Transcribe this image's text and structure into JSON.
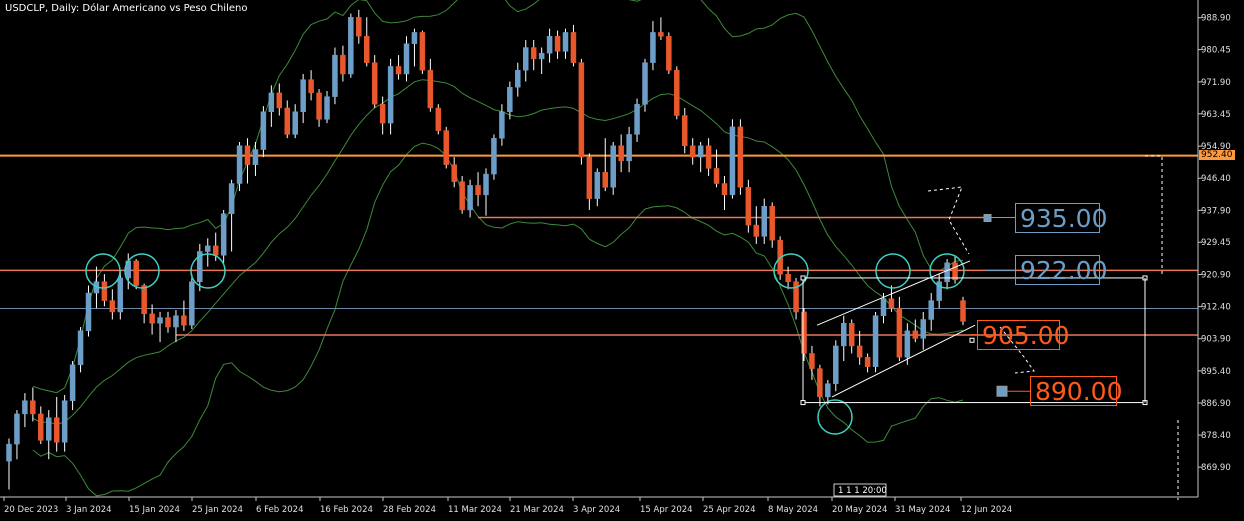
{
  "title": "USDCLP, Daily:  Dólar Americano vs Peso Chileno",
  "colors": {
    "background": "#000000",
    "bull": "#6d9ec8",
    "bear": "#e8582c",
    "bands": "#3e8a3a",
    "h_line": "#ff9a3c",
    "support_line": "#e8785a",
    "circle": "#3fd0c0",
    "level_blue": "#6d9ec8",
    "level_red": "#ff5a1a"
  },
  "price_tag": "952.40",
  "time_label": "1 1 1 20:00",
  "levels": [
    {
      "value": "935.00",
      "style": "blue"
    },
    {
      "value": "922.00",
      "style": "blue"
    },
    {
      "value": "905.00",
      "style": "red"
    },
    {
      "value": "890.00",
      "style": "red"
    }
  ],
  "chart_data": {
    "type": "candlestick",
    "symbol": "USDCLP",
    "timeframe": "Daily",
    "y_ticks": [
      "988.90",
      "980.45",
      "971.90",
      "963.45",
      "954.90",
      "946.40",
      "937.90",
      "929.45",
      "920.90",
      "912.40",
      "903.90",
      "895.40",
      "886.90",
      "878.40",
      "869.90"
    ],
    "x_ticks": [
      "20 Dec 2023",
      "3 Jan 2024",
      "15 Jan 2024",
      "25 Jan 2024",
      "6 Feb 2024",
      "16 Feb 2024",
      "28 Feb 2024",
      "11 Mar 2024",
      "21 Mar 2024",
      "3 Apr 2024",
      "15 Apr 2024",
      "25 Apr 2024",
      "8 May 2024",
      "20 May 2024",
      "31 May 2024",
      "12 Jun 2024"
    ],
    "ylim": [
      862,
      992
    ],
    "horizontal_levels": [
      952.4,
      936.0,
      922.0,
      904.9
    ],
    "candles": [
      {
        "o": 871.5,
        "h": 877.5,
        "l": 864.0,
        "c": 876.0
      },
      {
        "o": 876.0,
        "h": 885.0,
        "l": 872.0,
        "c": 884.0
      },
      {
        "o": 884.0,
        "h": 889.5,
        "l": 880.5,
        "c": 887.5
      },
      {
        "o": 887.5,
        "h": 891.0,
        "l": 882.0,
        "c": 884.0
      },
      {
        "o": 884.0,
        "h": 886.0,
        "l": 876.0,
        "c": 877.0
      },
      {
        "o": 877.0,
        "h": 885.0,
        "l": 872.0,
        "c": 883.0
      },
      {
        "o": 883.0,
        "h": 888.5,
        "l": 874.0,
        "c": 876.5
      },
      {
        "o": 876.5,
        "h": 889.0,
        "l": 874.0,
        "c": 887.5
      },
      {
        "o": 887.5,
        "h": 898.0,
        "l": 885.0,
        "c": 897.0
      },
      {
        "o": 897.0,
        "h": 907.0,
        "l": 895.0,
        "c": 906.0
      },
      {
        "o": 906.0,
        "h": 918.0,
        "l": 904.5,
        "c": 916.0
      },
      {
        "o": 916.0,
        "h": 923.0,
        "l": 912.0,
        "c": 919.0
      },
      {
        "o": 919.0,
        "h": 921.0,
        "l": 912.5,
        "c": 914.0
      },
      {
        "o": 914.0,
        "h": 917.0,
        "l": 909.0,
        "c": 911.0
      },
      {
        "o": 911.0,
        "h": 922.0,
        "l": 909.0,
        "c": 920.0
      },
      {
        "o": 920.0,
        "h": 926.5,
        "l": 917.0,
        "c": 924.5
      },
      {
        "o": 924.5,
        "h": 925.0,
        "l": 917.0,
        "c": 918.0
      },
      {
        "o": 918.0,
        "h": 918.5,
        "l": 908.0,
        "c": 910.5
      },
      {
        "o": 910.5,
        "h": 913.0,
        "l": 905.0,
        "c": 908.0
      },
      {
        "o": 908.0,
        "h": 911.0,
        "l": 903.0,
        "c": 909.5
      },
      {
        "o": 909.5,
        "h": 911.0,
        "l": 905.5,
        "c": 907.0
      },
      {
        "o": 907.0,
        "h": 911.5,
        "l": 903.0,
        "c": 910.0
      },
      {
        "o": 910.0,
        "h": 914.0,
        "l": 906.0,
        "c": 907.5
      },
      {
        "o": 907.5,
        "h": 921.0,
        "l": 906.5,
        "c": 919.0
      },
      {
        "o": 919.0,
        "h": 929.0,
        "l": 916.5,
        "c": 927.0
      },
      {
        "o": 927.0,
        "h": 930.5,
        "l": 923.0,
        "c": 928.5
      },
      {
        "o": 928.5,
        "h": 932.0,
        "l": 924.5,
        "c": 926.0
      },
      {
        "o": 926.0,
        "h": 938.0,
        "l": 924.0,
        "c": 937.0
      },
      {
        "o": 937.0,
        "h": 946.0,
        "l": 927.0,
        "c": 945.0
      },
      {
        "o": 945.0,
        "h": 956.0,
        "l": 943.0,
        "c": 955.0
      },
      {
        "o": 955.0,
        "h": 957.0,
        "l": 945.0,
        "c": 950.0
      },
      {
        "o": 950.0,
        "h": 956.0,
        "l": 947.0,
        "c": 954.0
      },
      {
        "o": 954.0,
        "h": 965.5,
        "l": 952.0,
        "c": 964.0
      },
      {
        "o": 964.0,
        "h": 971.0,
        "l": 960.0,
        "c": 969.0
      },
      {
        "o": 969.0,
        "h": 971.5,
        "l": 963.0,
        "c": 965.0
      },
      {
        "o": 965.0,
        "h": 967.0,
        "l": 957.0,
        "c": 958.0
      },
      {
        "o": 958.0,
        "h": 966.0,
        "l": 957.0,
        "c": 964.0
      },
      {
        "o": 964.0,
        "h": 974.0,
        "l": 961.0,
        "c": 972.5
      },
      {
        "o": 972.5,
        "h": 975.0,
        "l": 967.0,
        "c": 969.0
      },
      {
        "o": 969.0,
        "h": 970.0,
        "l": 960.0,
        "c": 962.0
      },
      {
        "o": 962.0,
        "h": 969.5,
        "l": 961.0,
        "c": 968.0
      },
      {
        "o": 968.0,
        "h": 981.0,
        "l": 966.0,
        "c": 979.0
      },
      {
        "o": 979.0,
        "h": 981.5,
        "l": 972.0,
        "c": 974.0
      },
      {
        "o": 974.0,
        "h": 990.0,
        "l": 973.0,
        "c": 989.0
      },
      {
        "o": 989.0,
        "h": 991.0,
        "l": 982.0,
        "c": 984.0
      },
      {
        "o": 984.0,
        "h": 989.0,
        "l": 976.0,
        "c": 977.0
      },
      {
        "o": 977.0,
        "h": 979.0,
        "l": 965.0,
        "c": 966.0
      },
      {
        "o": 966.0,
        "h": 968.0,
        "l": 958.0,
        "c": 961.0
      },
      {
        "o": 961.0,
        "h": 978.0,
        "l": 958.0,
        "c": 976.0
      },
      {
        "o": 976.0,
        "h": 979.0,
        "l": 972.5,
        "c": 974.0
      },
      {
        "o": 974.0,
        "h": 984.0,
        "l": 972.0,
        "c": 982.0
      },
      {
        "o": 982.0,
        "h": 986.0,
        "l": 976.0,
        "c": 985.0
      },
      {
        "o": 985.0,
        "h": 985.5,
        "l": 974.0,
        "c": 975.0
      },
      {
        "o": 975.0,
        "h": 978.0,
        "l": 964.0,
        "c": 965.0
      },
      {
        "o": 965.0,
        "h": 966.0,
        "l": 958.0,
        "c": 959.0
      },
      {
        "o": 959.0,
        "h": 960.0,
        "l": 949.0,
        "c": 950.0
      },
      {
        "o": 950.0,
        "h": 952.0,
        "l": 944.0,
        "c": 945.5
      },
      {
        "o": 945.5,
        "h": 947.0,
        "l": 937.0,
        "c": 938.0
      },
      {
        "o": 938.0,
        "h": 946.0,
        "l": 936.0,
        "c": 944.5
      },
      {
        "o": 944.5,
        "h": 948.0,
        "l": 939.0,
        "c": 942.0
      },
      {
        "o": 942.0,
        "h": 949.0,
        "l": 936.5,
        "c": 947.5
      },
      {
        "o": 947.5,
        "h": 958.0,
        "l": 946.0,
        "c": 957.0
      },
      {
        "o": 957.0,
        "h": 966.0,
        "l": 955.0,
        "c": 964.0
      },
      {
        "o": 964.0,
        "h": 972.0,
        "l": 962.0,
        "c": 970.5
      },
      {
        "o": 970.5,
        "h": 977.0,
        "l": 968.0,
        "c": 975.0
      },
      {
        "o": 975.0,
        "h": 983.0,
        "l": 972.0,
        "c": 981.0
      },
      {
        "o": 981.0,
        "h": 983.0,
        "l": 975.0,
        "c": 978.0
      },
      {
        "o": 978.0,
        "h": 981.0,
        "l": 974.0,
        "c": 979.5
      },
      {
        "o": 979.5,
        "h": 986.0,
        "l": 977.0,
        "c": 984.0
      },
      {
        "o": 984.0,
        "h": 985.5,
        "l": 978.0,
        "c": 980.0
      },
      {
        "o": 980.0,
        "h": 986.0,
        "l": 978.0,
        "c": 985.0
      },
      {
        "o": 985.0,
        "h": 987.0,
        "l": 976.0,
        "c": 977.0
      },
      {
        "o": 977.0,
        "h": 978.0,
        "l": 950.0,
        "c": 952.0
      },
      {
        "o": 952.0,
        "h": 953.0,
        "l": 938.0,
        "c": 941.0
      },
      {
        "o": 941.0,
        "h": 949.0,
        "l": 939.0,
        "c": 948.0
      },
      {
        "o": 948.0,
        "h": 957.0,
        "l": 943.0,
        "c": 944.0
      },
      {
        "o": 944.0,
        "h": 956.0,
        "l": 942.0,
        "c": 955.0
      },
      {
        "o": 955.0,
        "h": 958.0,
        "l": 948.0,
        "c": 951.0
      },
      {
        "o": 951.0,
        "h": 960.0,
        "l": 948.0,
        "c": 958.0
      },
      {
        "o": 958.0,
        "h": 967.5,
        "l": 956.0,
        "c": 966.0
      },
      {
        "o": 966.0,
        "h": 978.0,
        "l": 964.0,
        "c": 977.0
      },
      {
        "o": 977.0,
        "h": 988.0,
        "l": 975.0,
        "c": 985.0
      },
      {
        "o": 985.0,
        "h": 989.0,
        "l": 983.0,
        "c": 984.0
      },
      {
        "o": 984.0,
        "h": 985.0,
        "l": 974.0,
        "c": 975.0
      },
      {
        "o": 975.0,
        "h": 976.0,
        "l": 962.0,
        "c": 963.0
      },
      {
        "o": 963.0,
        "h": 965.0,
        "l": 953.0,
        "c": 955.0
      },
      {
        "o": 955.0,
        "h": 957.0,
        "l": 950.0,
        "c": 952.0
      },
      {
        "o": 952.0,
        "h": 956.0,
        "l": 948.0,
        "c": 955.0
      },
      {
        "o": 955.0,
        "h": 957.0,
        "l": 947.0,
        "c": 949.0
      },
      {
        "o": 949.0,
        "h": 954.0,
        "l": 944.0,
        "c": 945.0
      },
      {
        "o": 945.0,
        "h": 947.0,
        "l": 938.0,
        "c": 942.0
      },
      {
        "o": 942.0,
        "h": 962.0,
        "l": 941.0,
        "c": 960.0
      },
      {
        "o": 960.0,
        "h": 962.0,
        "l": 942.0,
        "c": 944.0
      },
      {
        "o": 944.0,
        "h": 946.0,
        "l": 932.0,
        "c": 934.0
      },
      {
        "o": 934.0,
        "h": 939.0,
        "l": 929.0,
        "c": 931.0
      },
      {
        "o": 931.0,
        "h": 941.0,
        "l": 929.0,
        "c": 939.0
      },
      {
        "o": 939.0,
        "h": 940.0,
        "l": 928.0,
        "c": 930.0
      },
      {
        "o": 930.0,
        "h": 931.0,
        "l": 919.5,
        "c": 921.0
      },
      {
        "o": 921.0,
        "h": 923.0,
        "l": 917.0,
        "c": 919.0
      },
      {
        "o": 919.0,
        "h": 920.0,
        "l": 909.0,
        "c": 911.0
      },
      {
        "o": 911.0,
        "h": 912.0,
        "l": 898.0,
        "c": 900.0
      },
      {
        "o": 900.0,
        "h": 902.0,
        "l": 893.0,
        "c": 896.0
      },
      {
        "o": 896.0,
        "h": 897.0,
        "l": 886.0,
        "c": 888.5
      },
      {
        "o": 888.5,
        "h": 893.0,
        "l": 886.5,
        "c": 892.0
      },
      {
        "o": 892.0,
        "h": 903.5,
        "l": 890.0,
        "c": 902.0
      },
      {
        "o": 902.0,
        "h": 910.0,
        "l": 898.0,
        "c": 908.0
      },
      {
        "o": 908.0,
        "h": 909.0,
        "l": 900.0,
        "c": 902.0
      },
      {
        "o": 902.0,
        "h": 906.0,
        "l": 897.0,
        "c": 899.0
      },
      {
        "o": 899.0,
        "h": 900.0,
        "l": 895.0,
        "c": 896.5
      },
      {
        "o": 896.5,
        "h": 911.0,
        "l": 895.0,
        "c": 910.0
      },
      {
        "o": 910.0,
        "h": 916.0,
        "l": 908.0,
        "c": 914.5
      },
      {
        "o": 914.5,
        "h": 918.0,
        "l": 911.0,
        "c": 912.0
      },
      {
        "o": 912.0,
        "h": 915.0,
        "l": 898.0,
        "c": 899.0
      },
      {
        "o": 899.0,
        "h": 908.0,
        "l": 897.0,
        "c": 906.0
      },
      {
        "o": 906.0,
        "h": 909.0,
        "l": 903.0,
        "c": 904.0
      },
      {
        "o": 904.0,
        "h": 911.0,
        "l": 901.0,
        "c": 909.0
      },
      {
        "o": 909.0,
        "h": 916.0,
        "l": 906.0,
        "c": 914.0
      },
      {
        "o": 914.0,
        "h": 921.0,
        "l": 912.0,
        "c": 919.0
      },
      {
        "o": 919.0,
        "h": 925.0,
        "l": 917.0,
        "c": 924.0
      },
      {
        "o": 924.0,
        "h": 926.0,
        "l": 918.5,
        "c": 919.5
      },
      {
        "o": 914.0,
        "h": 915.0,
        "l": 907.5,
        "c": 908.5
      }
    ]
  }
}
